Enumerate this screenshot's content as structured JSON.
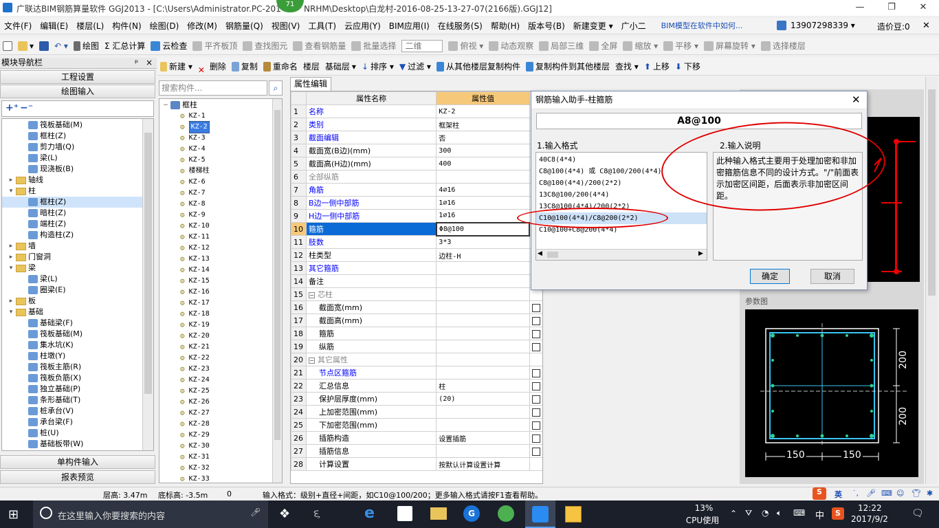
{
  "window": {
    "title": "广联达BIM钢筋算量软件 GGJ2013 - [C:\\Users\\Administrator.PC-201",
    "title_right": "NRHM\\Desktop\\白龙村-2016-08-25-13-27-07(2166版).GGJ12]",
    "badge": "71"
  },
  "menu": [
    "文件(F)",
    "编辑(E)",
    "楼层(L)",
    "构件(N)",
    "绘图(D)",
    "修改(M)",
    "钢筋量(Q)",
    "视图(V)",
    "工具(T)",
    "云应用(Y)",
    "BIM应用(I)",
    "在线服务(S)",
    "帮助(H)",
    "版本号(B)",
    "新建变更 ▾",
    "广小二",
    "BIM模型在软件中如何..."
  ],
  "menu_right": {
    "phone": "13907298339 ▾",
    "coins": "造价豆:0"
  },
  "toolbar": [
    "绘图",
    "Σ 汇总计算",
    "云检查",
    "平齐板顶",
    "查找图元",
    "查看钢筋量",
    "批量选择",
    "二维",
    "俯视 ▾",
    "动态观察",
    "局部三维",
    "全屏",
    "缩放 ▾",
    "平移 ▾",
    "屏幕旋转 ▾",
    "选择楼层"
  ],
  "toolbar2": [
    "新建 ▾",
    "删除",
    "复制",
    "重命名",
    "楼层",
    "基础层",
    "排序 ▾",
    "过滤 ▾",
    "从其他楼层复制构件",
    "复制构件到其他楼层",
    "查找 ▾",
    "上移",
    "下移"
  ],
  "nav": {
    "title": "模块导航栏",
    "pin": "ᵖ",
    "close": "×",
    "buttons": [
      "工程设置",
      "绘图输入"
    ],
    "bottom_buttons": [
      "单构件输入",
      "报表预览"
    ],
    "tree": [
      {
        "level": 2,
        "label": "筏板基础(M)",
        "type": "item"
      },
      {
        "level": 2,
        "label": "框柱(Z)",
        "type": "item"
      },
      {
        "level": 2,
        "label": "剪力墙(Q)",
        "type": "item"
      },
      {
        "level": 2,
        "label": "梁(L)",
        "type": "item"
      },
      {
        "level": 2,
        "label": "现浇板(B)",
        "type": "item"
      },
      {
        "level": 0,
        "label": "轴线",
        "type": "folder",
        "exp": "+"
      },
      {
        "level": 0,
        "label": "柱",
        "type": "folder",
        "exp": "−"
      },
      {
        "level": 2,
        "label": "框柱(Z)",
        "type": "item",
        "selected": true
      },
      {
        "level": 2,
        "label": "暗柱(Z)",
        "type": "item"
      },
      {
        "level": 2,
        "label": "端柱(Z)",
        "type": "item"
      },
      {
        "level": 2,
        "label": "构造柱(Z)",
        "type": "item"
      },
      {
        "level": 0,
        "label": "墙",
        "type": "folder",
        "exp": "+"
      },
      {
        "level": 0,
        "label": "门窗洞",
        "type": "folder",
        "exp": "+"
      },
      {
        "level": 0,
        "label": "梁",
        "type": "folder",
        "exp": "−"
      },
      {
        "level": 2,
        "label": "梁(L)",
        "type": "item"
      },
      {
        "level": 2,
        "label": "圈梁(E)",
        "type": "item"
      },
      {
        "level": 0,
        "label": "板",
        "type": "folder",
        "exp": "+"
      },
      {
        "level": 0,
        "label": "基础",
        "type": "folder",
        "exp": "−"
      },
      {
        "level": 2,
        "label": "基础梁(F)",
        "type": "item"
      },
      {
        "level": 2,
        "label": "筏板基础(M)",
        "type": "item"
      },
      {
        "level": 2,
        "label": "集水坑(K)",
        "type": "item"
      },
      {
        "level": 2,
        "label": "柱墩(Y)",
        "type": "item"
      },
      {
        "level": 2,
        "label": "筏板主筋(R)",
        "type": "item"
      },
      {
        "level": 2,
        "label": "筏板负筋(X)",
        "type": "item"
      },
      {
        "level": 2,
        "label": "独立基础(P)",
        "type": "item"
      },
      {
        "level": 2,
        "label": "条形基础(T)",
        "type": "item"
      },
      {
        "level": 2,
        "label": "桩承台(V)",
        "type": "item"
      },
      {
        "level": 2,
        "label": "承台梁(F)",
        "type": "item"
      },
      {
        "level": 2,
        "label": "桩(U)",
        "type": "item"
      },
      {
        "level": 2,
        "label": "基础板带(W)",
        "type": "item"
      }
    ]
  },
  "components": {
    "search_placeholder": "搜索构件...",
    "root": "框柱",
    "items": [
      "KZ-1",
      "KZ-2",
      "KZ-3",
      "KZ-4",
      "KZ-5",
      "楼梯柱",
      "KZ-6",
      "KZ-7",
      "KZ-8",
      "KZ-9",
      "KZ-10",
      "KZ-11",
      "KZ-12",
      "KZ-13",
      "KZ-14",
      "KZ-15",
      "KZ-16",
      "KZ-17",
      "KZ-18",
      "KZ-19",
      "KZ-20",
      "KZ-21",
      "KZ-22",
      "KZ-23",
      "KZ-24",
      "KZ-25",
      "KZ-26",
      "KZ-27",
      "KZ-28",
      "KZ-29",
      "KZ-30",
      "KZ-31",
      "KZ-32",
      "KZ-33"
    ],
    "selected": "KZ-2"
  },
  "props": {
    "tab": "属性编辑",
    "headers": [
      "属性名称",
      "属性值",
      "附"
    ],
    "rows": [
      {
        "n": "1",
        "name": "名称",
        "val": "KZ-2",
        "style": "blue",
        "ck": false
      },
      {
        "n": "2",
        "name": "类别",
        "val": "框架柱",
        "style": "blue",
        "ck": true
      },
      {
        "n": "3",
        "name": "截面编辑",
        "val": "否",
        "style": "blue",
        "ck": false
      },
      {
        "n": "4",
        "name": "截面宽(B边)(mm)",
        "val": "300",
        "style": "",
        "ck": true
      },
      {
        "n": "5",
        "name": "截面高(H边)(mm)",
        "val": "400",
        "style": "",
        "ck": true
      },
      {
        "n": "6",
        "name": "全部纵筋",
        "val": "",
        "style": "gray",
        "ck": false
      },
      {
        "n": "7",
        "name": "角筋",
        "val": "4⌀16",
        "style": "blue",
        "ck": true
      },
      {
        "n": "8",
        "name": "B边一侧中部筋",
        "val": "1⌀16",
        "style": "blue",
        "ck": true
      },
      {
        "n": "9",
        "name": "H边一侧中部筋",
        "val": "1⌀16",
        "style": "blue",
        "ck": true
      },
      {
        "n": "10",
        "name": "箍筋",
        "val": "Φ8@100",
        "style": "sel",
        "ck": true
      },
      {
        "n": "11",
        "name": "肢数",
        "val": "3*3",
        "style": "blue",
        "ck": false
      },
      {
        "n": "12",
        "name": "柱类型",
        "val": "边柱-H",
        "style": "",
        "ck": true
      },
      {
        "n": "13",
        "name": "其它箍筋",
        "val": "",
        "style": "blue",
        "ck": false
      },
      {
        "n": "14",
        "name": "备注",
        "val": "",
        "style": "",
        "ck": true
      },
      {
        "n": "15",
        "name": "芯柱",
        "val": "",
        "style": "group",
        "ck": false
      },
      {
        "n": "16",
        "name": "截面宽(mm)",
        "val": "",
        "style": "ind",
        "ck": true
      },
      {
        "n": "17",
        "name": "截面高(mm)",
        "val": "",
        "style": "ind",
        "ck": true
      },
      {
        "n": "18",
        "name": "箍筋",
        "val": "",
        "style": "ind",
        "ck": true
      },
      {
        "n": "19",
        "name": "纵筋",
        "val": "",
        "style": "ind",
        "ck": true
      },
      {
        "n": "20",
        "name": "其它属性",
        "val": "",
        "style": "group",
        "ck": false
      },
      {
        "n": "21",
        "name": "节点区箍筋",
        "val": "",
        "style": "indblue",
        "ck": true
      },
      {
        "n": "22",
        "name": "汇总信息",
        "val": "柱",
        "style": "ind",
        "ck": true
      },
      {
        "n": "23",
        "name": "保护层厚度(mm)",
        "val": "(20)",
        "style": "ind",
        "ck": true
      },
      {
        "n": "24",
        "name": "上加密范围(mm)",
        "val": "",
        "style": "ind",
        "ck": true
      },
      {
        "n": "25",
        "name": "下加密范围(mm)",
        "val": "",
        "style": "ind",
        "ck": true
      },
      {
        "n": "26",
        "name": "插筋构造",
        "val": "设置插筋",
        "style": "ind",
        "ck": true
      },
      {
        "n": "27",
        "name": "插筋信息",
        "val": "",
        "style": "ind",
        "ck": true
      },
      {
        "n": "28",
        "name": "计算设置",
        "val": "按默认计算设置计算",
        "style": "ind",
        "ck": false
      }
    ]
  },
  "dialog": {
    "title": "钢筋输入助手-柱箍筋",
    "input": "A8@100",
    "sec1": "1.输入格式",
    "sec2": "2.输入说明",
    "formats": [
      "40C8(4*4)",
      "C8@100(4*4) 或 C8@100/200(4*4)",
      "C8@100(4*4)/200(2*2)",
      "13C8@100/200(4*4)",
      "13C8@100(4*4)/200(2*2)",
      "C10@100(4*4)/C8@200(2*2)",
      "C10@100+C8@200(4*4)"
    ],
    "selected_format": 5,
    "desc": "此种输入格式主要用于处理加密和非加密箍筋信息不同的设计方式。\"/\"前面表示加密区间距，后面表示非加密区间距。",
    "ok": "确定",
    "cancel": "取消"
  },
  "param": {
    "label": "参数图",
    "dim1": "200",
    "dim2": "200",
    "dim3": "150",
    "dim4": "150"
  },
  "status": {
    "floor_h": "层高: 3.47m",
    "base_h": "底标高: -3.5m",
    "zero": "0",
    "hint": "输入格式：级别+直径+间距，如C10@100/200；更多输入格式请按F1查看帮助。"
  },
  "taskbar": {
    "search": "在这里输入你要搜索的内容",
    "cpu_pct": "13%",
    "cpu_label": "CPU使用",
    "time": "12:22",
    "date": "2017/9/2",
    "lang": "中",
    "ime": "英"
  },
  "colors": {
    "accent": "#0078d7",
    "selection": "#0a6ad6",
    "annotation": "#e00000"
  }
}
